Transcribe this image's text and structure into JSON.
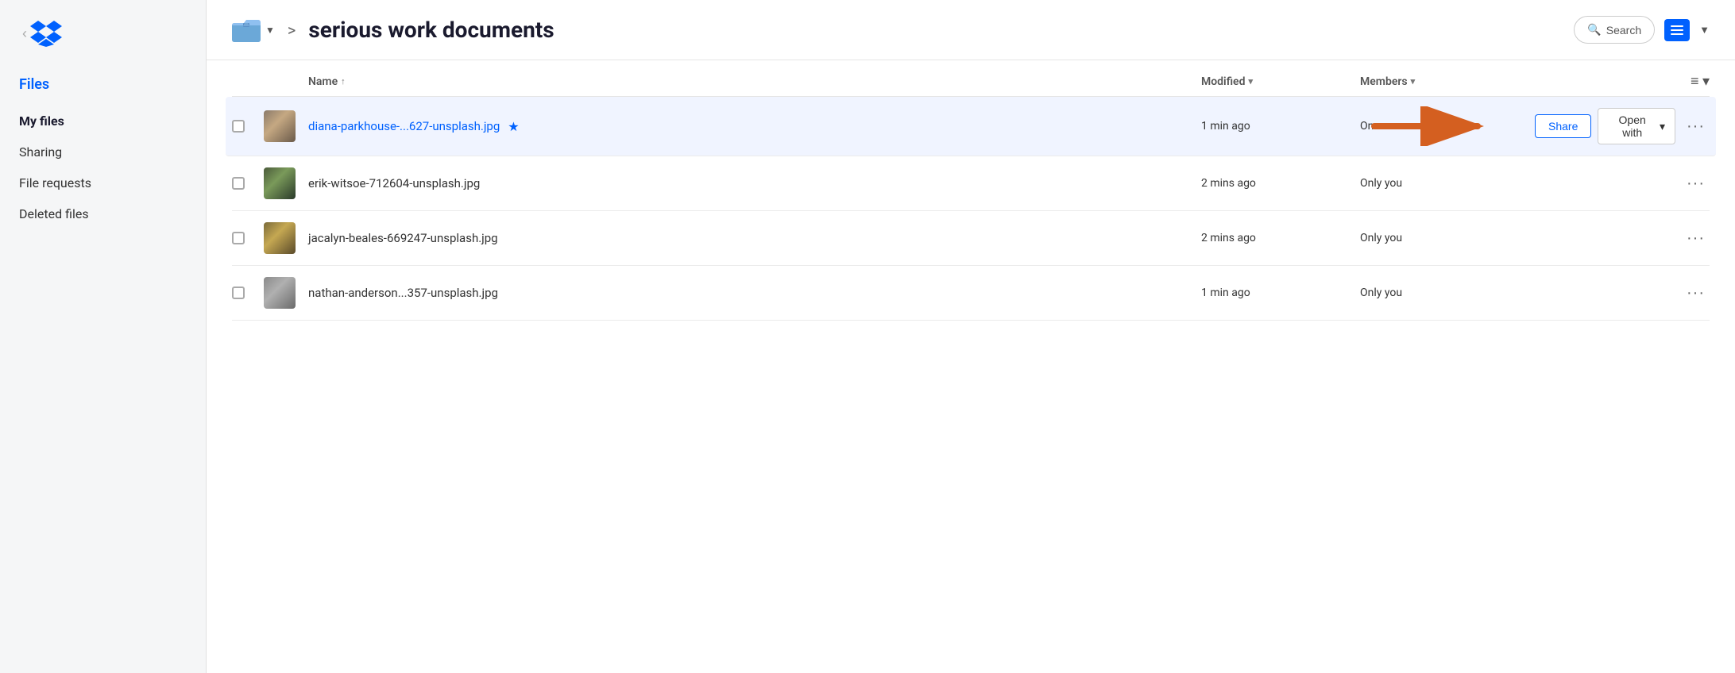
{
  "sidebar": {
    "logo_alt": "Dropbox logo",
    "section_label": "Files",
    "nav_items": [
      {
        "id": "my-files",
        "label": "My files",
        "active": true
      },
      {
        "id": "sharing",
        "label": "Sharing",
        "active": false
      },
      {
        "id": "file-requests",
        "label": "File requests",
        "active": false
      },
      {
        "id": "deleted-files",
        "label": "Deleted files",
        "active": false
      }
    ]
  },
  "header": {
    "folder_label": "serious work documents",
    "breadcrumb_separator": ">",
    "search_placeholder": "Se...",
    "search_label": "Search"
  },
  "table": {
    "columns": {
      "name": "Name",
      "modified": "Modified",
      "members": "Members"
    },
    "sort_direction": "↑",
    "rows": [
      {
        "id": "row-1",
        "name": "diana-parkhouse-...627-unsplash.jpg",
        "is_link": true,
        "starred": true,
        "modified": "1 min ago",
        "members": "On",
        "thumb_class": "thumb-cat1",
        "active": true,
        "share_label": "Share",
        "open_with_label": "Open with",
        "more_label": "···"
      },
      {
        "id": "row-2",
        "name": "erik-witsoe-712604-unsplash.jpg",
        "is_link": false,
        "starred": false,
        "modified": "2 mins ago",
        "members": "Only you",
        "thumb_class": "thumb-cat2",
        "active": false,
        "more_label": "···"
      },
      {
        "id": "row-3",
        "name": "jacalyn-beales-669247-unsplash.jpg",
        "is_link": false,
        "starred": false,
        "modified": "2 mins ago",
        "members": "Only you",
        "thumb_class": "thumb-lion",
        "active": false,
        "more_label": "···"
      },
      {
        "id": "row-4",
        "name": "nathan-anderson...357-unsplash.jpg",
        "is_link": false,
        "starred": false,
        "modified": "1 min ago",
        "members": "Only you",
        "thumb_class": "thumb-concrete",
        "active": false,
        "more_label": "···"
      }
    ]
  },
  "arrow": {
    "label": "arrow pointing to Share button"
  }
}
